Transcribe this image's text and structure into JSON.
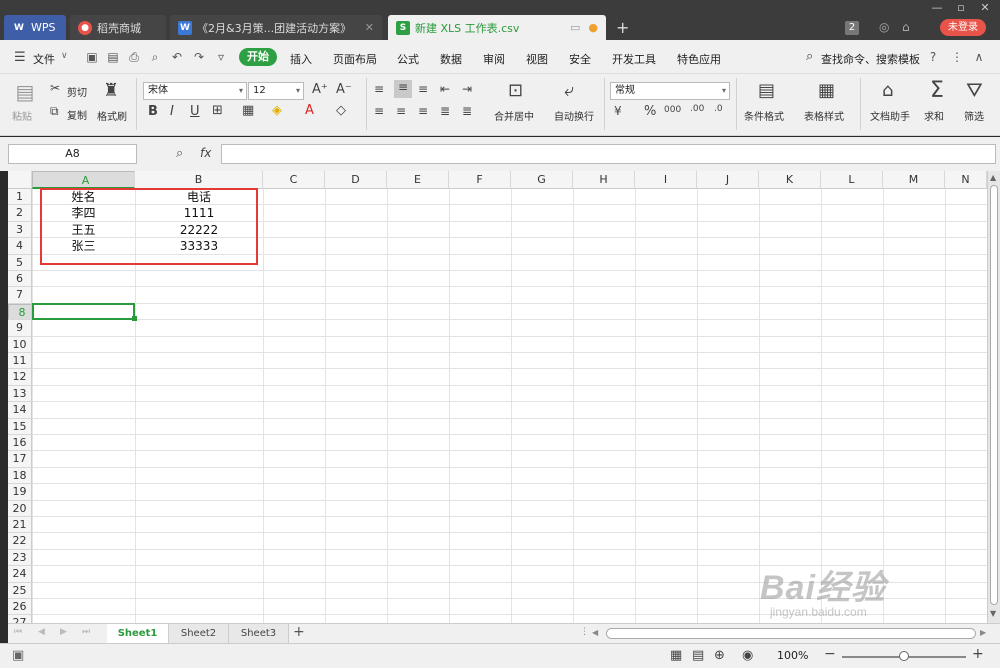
{
  "tabs": [
    {
      "label": "WPS",
      "icon": "wps-logo-icon"
    },
    {
      "label": "稻壳商城",
      "icon": "docer-icon"
    },
    {
      "label": "《2月&3月策...团建活动方案》",
      "icon": "wps-writer-icon"
    },
    {
      "label": "新建 XLS 工作表.csv",
      "icon": "spreadsheet-icon"
    }
  ],
  "window_badge": "2",
  "login_button": "未登录",
  "menu": {
    "file": "文件",
    "start": "开始",
    "items": [
      "插入",
      "页面布局",
      "公式",
      "数据",
      "审阅",
      "视图",
      "安全",
      "开发工具",
      "特色应用"
    ],
    "search": "查找命令、搜索模板"
  },
  "ribbon": {
    "paste": "粘贴",
    "cut": "剪切",
    "copy": "复制",
    "format_painter": "格式刷",
    "font_name": "宋体",
    "font_size": "12",
    "merge_center": "合并居中",
    "auto_wrap": "自动换行",
    "number_format": "常规",
    "conditional_format": "条件格式",
    "table_style": "表格样式",
    "doc_assistant": "文档助手",
    "sum": "求和",
    "filter": "筛选"
  },
  "formula_bar": {
    "name_box": "A8",
    "fx": "fx",
    "value": ""
  },
  "columns": [
    "A",
    "B",
    "C",
    "D",
    "E",
    "F",
    "G",
    "H",
    "I",
    "J",
    "K",
    "L",
    "M",
    "N"
  ],
  "rows": [
    "1",
    "2",
    "3",
    "4",
    "5",
    "6",
    "7",
    "8",
    "9",
    "10",
    "11",
    "12",
    "13",
    "14",
    "15",
    "16",
    "17",
    "18",
    "19",
    "20",
    "21",
    "22",
    "23",
    "24",
    "25",
    "26",
    "27"
  ],
  "cells": [
    {
      "a": "姓名",
      "b": "电话"
    },
    {
      "a": "李四",
      "b": "1111"
    },
    {
      "a": "王五",
      "b": "22222"
    },
    {
      "a": "张三",
      "b": "33333"
    }
  ],
  "sheets": [
    "Sheet1",
    "Sheet2",
    "Sheet3"
  ],
  "zoom": "100%",
  "watermark": {
    "brand": "Bai经验",
    "url": "jingyan.baidu.com"
  },
  "colors": {
    "accent": "#2a9b3a",
    "highlight_box": "#e53935",
    "login": "#e8534a"
  }
}
